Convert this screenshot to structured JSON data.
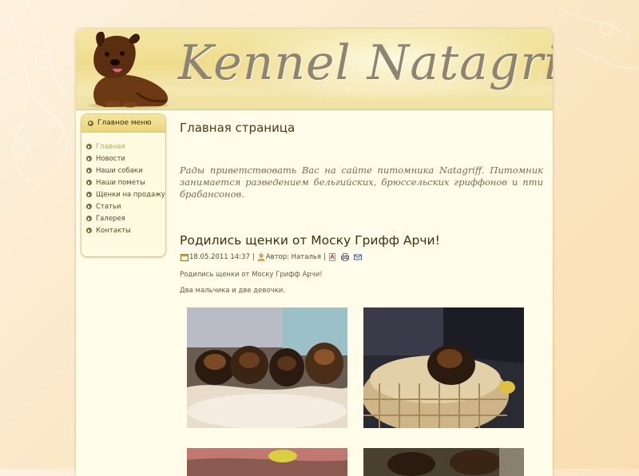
{
  "site": {
    "logo_text": "Kennel Natagriff"
  },
  "sidebar": {
    "header": "Главное меню",
    "items": [
      {
        "label": "Главная",
        "active": true
      },
      {
        "label": "Новости",
        "active": false
      },
      {
        "label": "Наши собаки",
        "active": false
      },
      {
        "label": "Наши пометы",
        "active": false
      },
      {
        "label": "Щенки на продажу",
        "active": false
      },
      {
        "label": "Статьи",
        "active": false
      },
      {
        "label": "Галерея",
        "active": false
      },
      {
        "label": "Контакты",
        "active": false
      }
    ]
  },
  "main": {
    "page_title": "Главная страница",
    "welcome_text": "Рады приветствовать Вас на сайте питомника Natagriff. Питомник занимается разведением бельгийских, брюссельских гриффонов и пти брабансонов.",
    "article": {
      "title": "Родились щенки от Моску Грифф Арчи!",
      "date": "18.05.2011 14:37",
      "author": "Автор: Наталья",
      "paragraph1": "Родились щенки от Моску Грифф Арчи!",
      "paragraph2": "Два мальчика и две девочки."
    }
  },
  "icons": [
    "calendar-icon",
    "author-icon",
    "pdf-icon",
    "print-icon",
    "email-icon",
    "menu-bullet-icon"
  ],
  "colors": {
    "page_bg": "#fbe8c8",
    "content_bg": "#fffde9",
    "header_gold": "#efdc8d",
    "active_link": "#c9a634",
    "text_dark": "#4c3a18"
  }
}
